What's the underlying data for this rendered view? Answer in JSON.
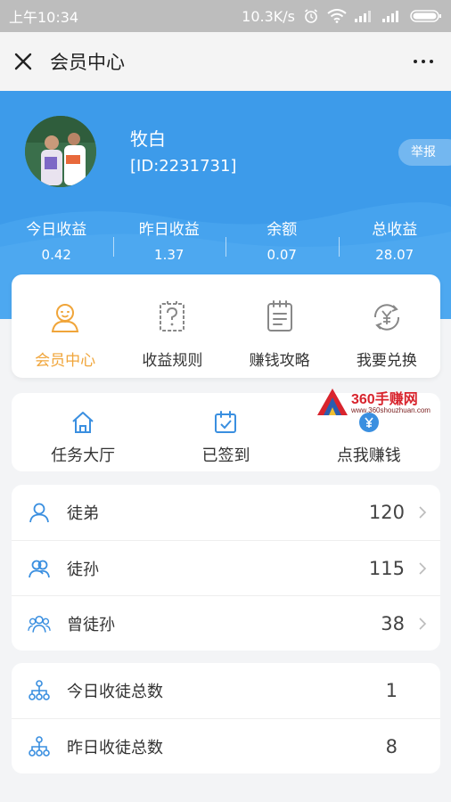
{
  "status_bar": {
    "time": "上午10:34",
    "network_speed": "10.3K/s"
  },
  "nav": {
    "title": "会员中心"
  },
  "profile": {
    "name": "牧白",
    "id": "[ID:2231731]",
    "report_label": "举报"
  },
  "stats": [
    {
      "label": "今日收益",
      "value": "0.42"
    },
    {
      "label": "昨日收益",
      "value": "1.37"
    },
    {
      "label": "余额",
      "value": "0.07"
    },
    {
      "label": "总收益",
      "value": "28.07"
    }
  ],
  "menu": [
    {
      "label": "会员中心",
      "icon": "member-icon",
      "active": true
    },
    {
      "label": "收益规则",
      "icon": "rules-icon"
    },
    {
      "label": "赚钱攻略",
      "icon": "guide-icon"
    },
    {
      "label": "我要兑换",
      "icon": "exchange-icon"
    }
  ],
  "tasks": [
    {
      "label": "任务大厅",
      "icon": "home-icon"
    },
    {
      "label": "已签到",
      "icon": "calendar-check-icon"
    },
    {
      "label": "点我赚钱",
      "icon": "coin-icon"
    }
  ],
  "watermark": {
    "title": "360手赚网",
    "url": "www.360shouzhuan.com"
  },
  "disciples": [
    {
      "label": "徒弟",
      "value": "120"
    },
    {
      "label": "徒孙",
      "value": "115"
    },
    {
      "label": "曾徒孙",
      "value": "38"
    }
  ],
  "recruit": [
    {
      "label": "今日收徒总数",
      "value": "1"
    },
    {
      "label": "昨日收徒总数",
      "value": "8"
    }
  ],
  "colors": {
    "primary_blue": "#3d9bea",
    "accent_orange": "#f0a53a",
    "icon_blue": "#3a8fe0"
  }
}
